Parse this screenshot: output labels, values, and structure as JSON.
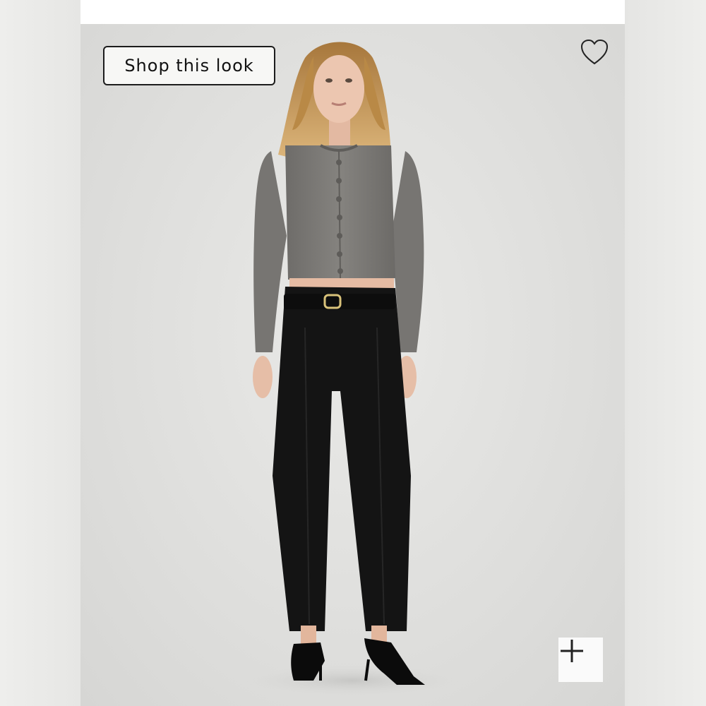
{
  "shop_this_look": {
    "label": "Shop this look"
  },
  "favorite": {
    "icon": "heart-outline-icon"
  },
  "zoom": {
    "icon": "plus-icon"
  },
  "photo": {
    "subject": "model-full-body",
    "colors": {
      "backdrop": "#dededc",
      "cardigan": "#7d7b78",
      "trousers": "#121212",
      "hair": "#c79a5c",
      "skin": "#e8c2ac"
    }
  }
}
